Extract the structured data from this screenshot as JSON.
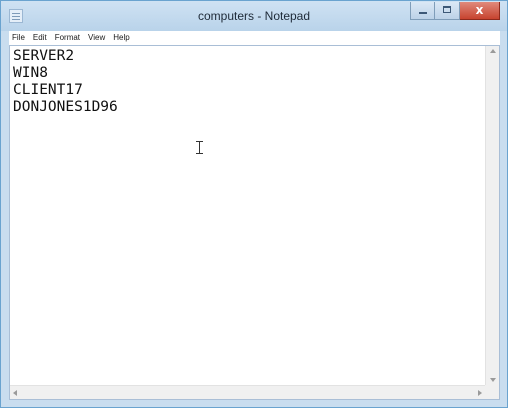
{
  "window": {
    "title": "computers - Notepad",
    "app_icon": "notepad-icon",
    "close_glyph": "x"
  },
  "menu": {
    "items": [
      "File",
      "Edit",
      "Format",
      "View",
      "Help"
    ]
  },
  "editor": {
    "lines": [
      "SERVER2",
      "WIN8",
      "CLIENT17",
      "DONJONES1D96"
    ]
  },
  "colors": {
    "title_bar": "#c9ddef",
    "close_button": "#c7432f",
    "editor_background": "#ffffff"
  }
}
